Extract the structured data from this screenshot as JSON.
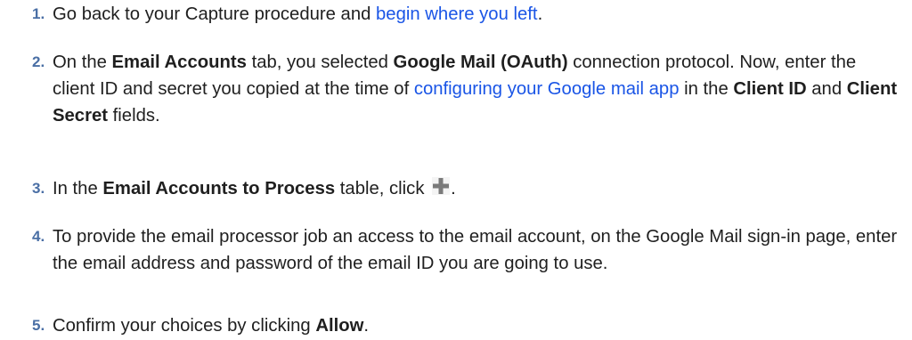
{
  "steps": [
    {
      "number": "1.",
      "pre": "Go back to your Capture procedure and ",
      "link": "begin where you left",
      "post": "."
    },
    {
      "number": "2.",
      "t1": "On the ",
      "b1": "Email Accounts",
      "t2": " tab, you selected ",
      "b2": "Google Mail (OAuth)",
      "t3": " connection protocol. Now, enter the client ID and secret you copied at the time of ",
      "link": "configuring your Google mail app",
      "t4": " in the ",
      "b3": "Client ID",
      "t5": " and ",
      "b4": "Client Secret",
      "t6": " fields."
    },
    {
      "number": "3.",
      "t1": "In the ",
      "b1": "Email Accounts to Process",
      "t2": " table, click ",
      "icon": "add-plus-icon",
      "t3": "."
    },
    {
      "number": "4.",
      "text": "To provide the email processor job an access to the email account, on the Google Mail sign-in page, enter the email address and password of the email ID you are going to use."
    },
    {
      "number": "5.",
      "t1": "Confirm your choices by clicking ",
      "b1": "Allow",
      "t2": "."
    }
  ],
  "colors": {
    "number": "#4a6fa5",
    "link": "#1a55e6",
    "text": "#1f1f1f",
    "icon": "#7a7a7a"
  }
}
